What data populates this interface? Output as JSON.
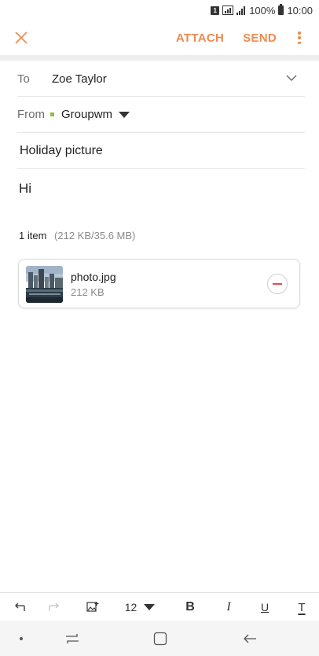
{
  "status_bar": {
    "sim_badge": "1",
    "battery": "100%",
    "time": "10:00"
  },
  "app_bar": {
    "close_icon": "close-x-icon",
    "attach_label": "ATTACH",
    "send_label": "SEND",
    "accent_color": "#ee8a4f"
  },
  "compose": {
    "to_label": "To",
    "to_value": "Zoe Taylor",
    "from_label": "From",
    "from_value": "Groupwm",
    "account_color": "#8dbf3f",
    "subject": "Holiday picture",
    "body": "Hi"
  },
  "attachments": {
    "count_label": "1 item",
    "size_label": "(212 KB/35.6 MB)",
    "items": [
      {
        "name": "photo.jpg",
        "size": "212 KB"
      }
    ]
  },
  "toolbar": {
    "font_size": "12",
    "bold": "B",
    "italic": "I",
    "underline": "U",
    "text_style": "T"
  }
}
